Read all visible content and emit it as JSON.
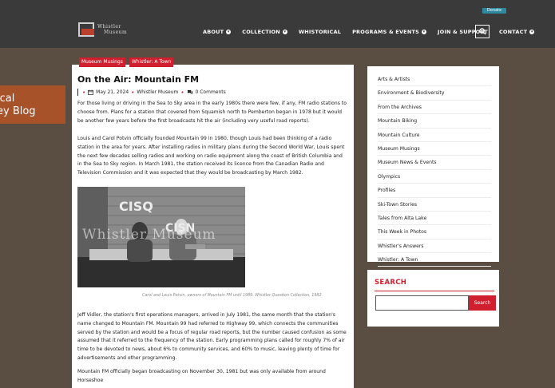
{
  "header": {
    "logo_line1": "Whistler",
    "logo_line2": "Museum",
    "donate_label": "Donate",
    "nav": [
      {
        "label": "ABOUT",
        "has_dropdown": true
      },
      {
        "label": "COLLECTION",
        "has_dropdown": true
      },
      {
        "label": "WHISTORICAL",
        "has_dropdown": false
      },
      {
        "label": "PROGRAMS & EVENTS",
        "has_dropdown": true
      },
      {
        "label": "JOIN & SUPPORT",
        "has_dropdown": false
      },
      {
        "label": "CONTACT",
        "has_dropdown": true
      }
    ],
    "search_icon": "search-icon"
  },
  "hero": {
    "line1": "ical",
    "line2": "ey Blog"
  },
  "post": {
    "tags": [
      "Museum Musings",
      "Whistler: A Town"
    ],
    "title": "On the Air: Mountain FM",
    "date": "May 21, 2024",
    "author": "Whistler Museum",
    "comments": "0 Comments",
    "para1": "For those living or driving in the Sea to Sky area in the early 1980s there were few, if any, FM radio stations to choose from. Plans for a station that covered from Squamish north to Pemberton began in 1978 but it would be another few years before the first broadcasts hit the air (including very useful road reports).",
    "para2": "Louis and Carol Potvin officially founded Mountain 99 in 1980, though Louis had been thinking of a radio station in the area for years. After installing radios in military plans during the Second World War, Louis spent the next few decades selling radios and working on radio equipment along the coast of British Columbia and in the Sea to Sky region. In March 1981, the station received its licence from the Canadian Radio and Television Commission and it was expected that they would be broadcasting by March 1982.",
    "photo_sign1": "CISQ",
    "photo_sign2": "CISN",
    "photo_watermark": "Whistler Museum",
    "photo_caption": "Carol and Louis Potvin, owners of Mountain FM until 1989. Whistler Question Collection, 1982",
    "para3": "Jeff Vidler, the station's first operations managers, arrived in July 1981, the same month that the station's name changed to Mountain FM. Mountain 99 had referred to Highway 99, which connects the communities served by the station and would be a focus of regular road reports, but the number caused confusion as some assumed that it referred to the frequency of the station. Early programming plans called for roughly 7% of air time to be devoted to news, about 6% to community services, and 60% to music, leaving plenty of time for advertisements and other programming.",
    "para4": "Mountain FM officially began broadcasting on November 30, 1981 but was only available from around Horseshoe"
  },
  "sidebar": {
    "categories": [
      "Arts & Artists",
      "Environment & Biodiversity",
      "From the Archives",
      "Mountain Biking",
      "Mountain Culture",
      "Museum Musings",
      "Museum News & Events",
      "Olympics",
      "Profiles",
      "Ski-Town Stories",
      "Tales from Alta Lake",
      "This Week in Photos",
      "Whistler's Answers",
      "Whistler: A Town"
    ],
    "search_title": "SEARCH",
    "search_placeholder": "",
    "search_button": "Search"
  },
  "colors": {
    "header_bg": "#3a3a3a",
    "page_bg": "#5a4d42",
    "accent_red": "#d0202f",
    "hero_orange": "#a8522a",
    "donate_teal": "#2f8aa0"
  }
}
